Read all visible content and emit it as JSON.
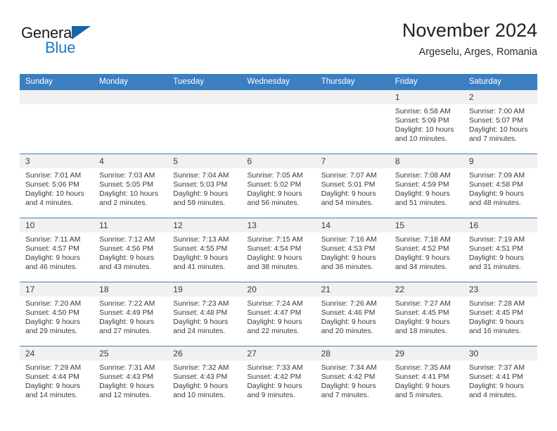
{
  "brand": {
    "name_top": "General",
    "name_bottom": "Blue",
    "accent_color": "#2077c4",
    "triangle_color": "#1565ad"
  },
  "header": {
    "title": "November 2024",
    "subtitle": "Argeselu, Arges, Romania"
  },
  "theme": {
    "header_row_bg": "#3c7fc1",
    "daynum_bg": "#f1f1f1",
    "text_color": "#3a3a3a"
  },
  "weekday_headers": [
    "Sunday",
    "Monday",
    "Tuesday",
    "Wednesday",
    "Thursday",
    "Friday",
    "Saturday"
  ],
  "weeks": [
    [
      {
        "day": "",
        "empty": true
      },
      {
        "day": "",
        "empty": true
      },
      {
        "day": "",
        "empty": true
      },
      {
        "day": "",
        "empty": true
      },
      {
        "day": "",
        "empty": true
      },
      {
        "day": "1",
        "sunrise": "Sunrise: 6:58 AM",
        "sunset": "Sunset: 5:09 PM",
        "daylight": "Daylight: 10 hours and 10 minutes."
      },
      {
        "day": "2",
        "sunrise": "Sunrise: 7:00 AM",
        "sunset": "Sunset: 5:07 PM",
        "daylight": "Daylight: 10 hours and 7 minutes."
      }
    ],
    [
      {
        "day": "3",
        "sunrise": "Sunrise: 7:01 AM",
        "sunset": "Sunset: 5:06 PM",
        "daylight": "Daylight: 10 hours and 4 minutes."
      },
      {
        "day": "4",
        "sunrise": "Sunrise: 7:03 AM",
        "sunset": "Sunset: 5:05 PM",
        "daylight": "Daylight: 10 hours and 2 minutes."
      },
      {
        "day": "5",
        "sunrise": "Sunrise: 7:04 AM",
        "sunset": "Sunset: 5:03 PM",
        "daylight": "Daylight: 9 hours and 59 minutes."
      },
      {
        "day": "6",
        "sunrise": "Sunrise: 7:05 AM",
        "sunset": "Sunset: 5:02 PM",
        "daylight": "Daylight: 9 hours and 56 minutes."
      },
      {
        "day": "7",
        "sunrise": "Sunrise: 7:07 AM",
        "sunset": "Sunset: 5:01 PM",
        "daylight": "Daylight: 9 hours and 54 minutes."
      },
      {
        "day": "8",
        "sunrise": "Sunrise: 7:08 AM",
        "sunset": "Sunset: 4:59 PM",
        "daylight": "Daylight: 9 hours and 51 minutes."
      },
      {
        "day": "9",
        "sunrise": "Sunrise: 7:09 AM",
        "sunset": "Sunset: 4:58 PM",
        "daylight": "Daylight: 9 hours and 48 minutes."
      }
    ],
    [
      {
        "day": "10",
        "sunrise": "Sunrise: 7:11 AM",
        "sunset": "Sunset: 4:57 PM",
        "daylight": "Daylight: 9 hours and 46 minutes."
      },
      {
        "day": "11",
        "sunrise": "Sunrise: 7:12 AM",
        "sunset": "Sunset: 4:56 PM",
        "daylight": "Daylight: 9 hours and 43 minutes."
      },
      {
        "day": "12",
        "sunrise": "Sunrise: 7:13 AM",
        "sunset": "Sunset: 4:55 PM",
        "daylight": "Daylight: 9 hours and 41 minutes."
      },
      {
        "day": "13",
        "sunrise": "Sunrise: 7:15 AM",
        "sunset": "Sunset: 4:54 PM",
        "daylight": "Daylight: 9 hours and 38 minutes."
      },
      {
        "day": "14",
        "sunrise": "Sunrise: 7:16 AM",
        "sunset": "Sunset: 4:53 PM",
        "daylight": "Daylight: 9 hours and 36 minutes."
      },
      {
        "day": "15",
        "sunrise": "Sunrise: 7:18 AM",
        "sunset": "Sunset: 4:52 PM",
        "daylight": "Daylight: 9 hours and 34 minutes."
      },
      {
        "day": "16",
        "sunrise": "Sunrise: 7:19 AM",
        "sunset": "Sunset: 4:51 PM",
        "daylight": "Daylight: 9 hours and 31 minutes."
      }
    ],
    [
      {
        "day": "17",
        "sunrise": "Sunrise: 7:20 AM",
        "sunset": "Sunset: 4:50 PM",
        "daylight": "Daylight: 9 hours and 29 minutes."
      },
      {
        "day": "18",
        "sunrise": "Sunrise: 7:22 AM",
        "sunset": "Sunset: 4:49 PM",
        "daylight": "Daylight: 9 hours and 27 minutes."
      },
      {
        "day": "19",
        "sunrise": "Sunrise: 7:23 AM",
        "sunset": "Sunset: 4:48 PM",
        "daylight": "Daylight: 9 hours and 24 minutes."
      },
      {
        "day": "20",
        "sunrise": "Sunrise: 7:24 AM",
        "sunset": "Sunset: 4:47 PM",
        "daylight": "Daylight: 9 hours and 22 minutes."
      },
      {
        "day": "21",
        "sunrise": "Sunrise: 7:26 AM",
        "sunset": "Sunset: 4:46 PM",
        "daylight": "Daylight: 9 hours and 20 minutes."
      },
      {
        "day": "22",
        "sunrise": "Sunrise: 7:27 AM",
        "sunset": "Sunset: 4:45 PM",
        "daylight": "Daylight: 9 hours and 18 minutes."
      },
      {
        "day": "23",
        "sunrise": "Sunrise: 7:28 AM",
        "sunset": "Sunset: 4:45 PM",
        "daylight": "Daylight: 9 hours and 16 minutes."
      }
    ],
    [
      {
        "day": "24",
        "sunrise": "Sunrise: 7:29 AM",
        "sunset": "Sunset: 4:44 PM",
        "daylight": "Daylight: 9 hours and 14 minutes."
      },
      {
        "day": "25",
        "sunrise": "Sunrise: 7:31 AM",
        "sunset": "Sunset: 4:43 PM",
        "daylight": "Daylight: 9 hours and 12 minutes."
      },
      {
        "day": "26",
        "sunrise": "Sunrise: 7:32 AM",
        "sunset": "Sunset: 4:43 PM",
        "daylight": "Daylight: 9 hours and 10 minutes."
      },
      {
        "day": "27",
        "sunrise": "Sunrise: 7:33 AM",
        "sunset": "Sunset: 4:42 PM",
        "daylight": "Daylight: 9 hours and 9 minutes."
      },
      {
        "day": "28",
        "sunrise": "Sunrise: 7:34 AM",
        "sunset": "Sunset: 4:42 PM",
        "daylight": "Daylight: 9 hours and 7 minutes."
      },
      {
        "day": "29",
        "sunrise": "Sunrise: 7:35 AM",
        "sunset": "Sunset: 4:41 PM",
        "daylight": "Daylight: 9 hours and 5 minutes."
      },
      {
        "day": "30",
        "sunrise": "Sunrise: 7:37 AM",
        "sunset": "Sunset: 4:41 PM",
        "daylight": "Daylight: 9 hours and 4 minutes."
      }
    ]
  ]
}
